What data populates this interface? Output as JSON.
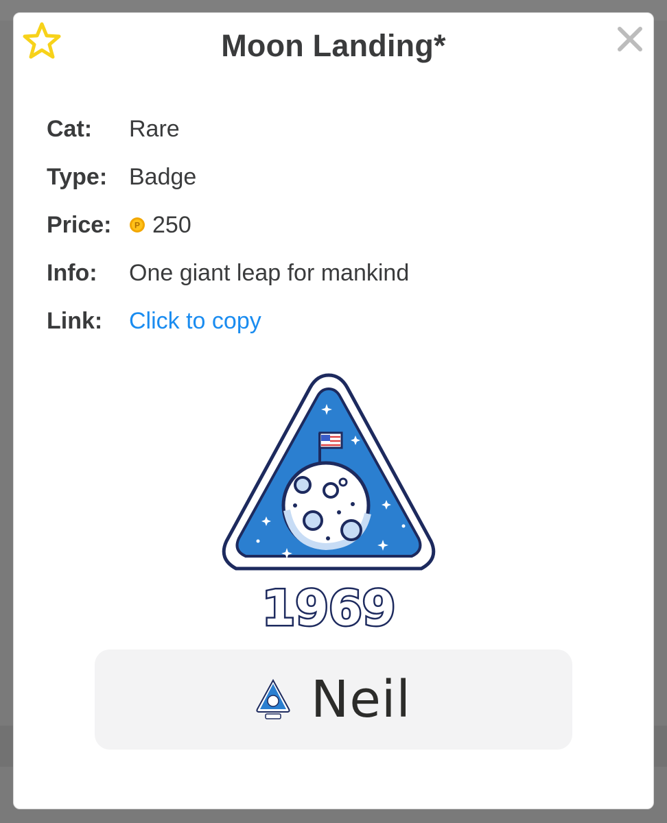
{
  "modal": {
    "title": "Moon Landing*",
    "favorite_icon": "star-outline-icon",
    "close_icon": "close-icon"
  },
  "details": {
    "cat_label": "Cat:",
    "cat_value": "Rare",
    "type_label": "Type:",
    "type_value": "Badge",
    "price_label": "Price:",
    "price_icon": "coin-icon",
    "price_value": "250",
    "info_label": "Info:",
    "info_value": "One giant leap for mankind",
    "link_label": "Link:",
    "link_value": "Click to copy"
  },
  "badge": {
    "year": "1969",
    "name_preview": "Neil"
  },
  "colors": {
    "star": "#f7d21a",
    "link": "#1a8cf0",
    "badge_navy": "#1d2a5e",
    "badge_blue": "#2b7fd0",
    "coin": "#f2a700"
  }
}
